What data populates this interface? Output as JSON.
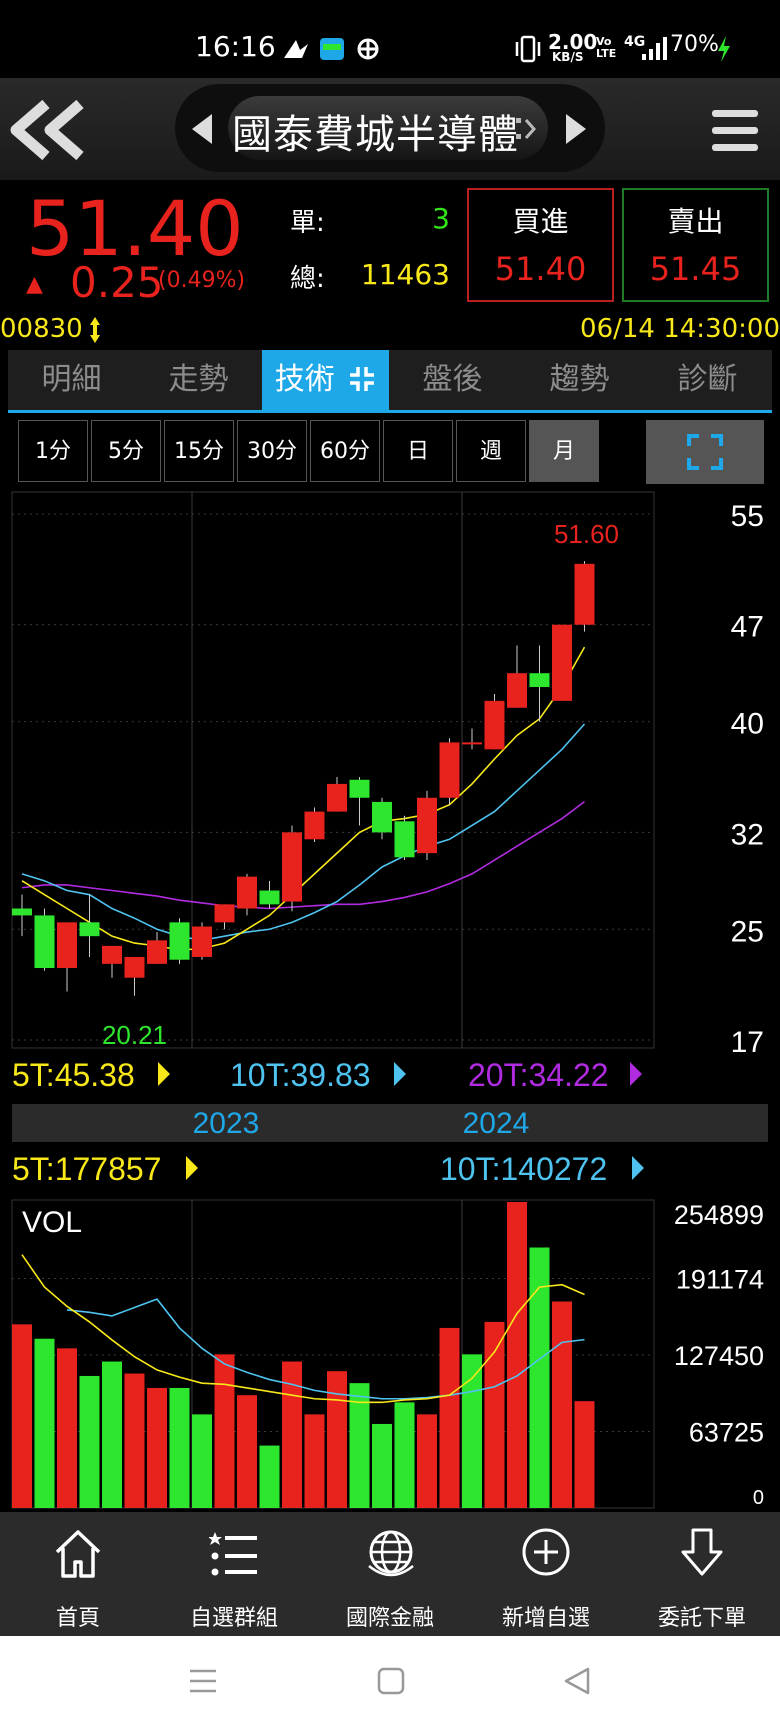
{
  "status": {
    "time": "16:16",
    "net_speed": "2.00",
    "net_unit": "KB/S",
    "volte": "Vo LTE",
    "net_type": "4G",
    "battery": "70%"
  },
  "header": {
    "title": "國泰費城半導體"
  },
  "quote": {
    "price": "51.40",
    "change_arrow": "▲",
    "change": "0.25",
    "change_pct": "(0.49%)",
    "single_label": "單:",
    "single_value": "3",
    "total_label": "總:",
    "total_value": "11463",
    "buy_label": "買進",
    "buy_price": "51.40",
    "sell_label": "賣出",
    "sell_price": "51.45"
  },
  "codebar": {
    "code": "00830",
    "datetime": "06/14 14:30:00"
  },
  "tabs": [
    "明細",
    "走勢",
    "技術",
    "盤後",
    "趨勢",
    "診斷"
  ],
  "active_tab": 2,
  "periods": [
    "1分",
    "5分",
    "15分",
    "30分",
    "60分",
    "日",
    "週",
    "月"
  ],
  "active_period": 7,
  "ma_legend": {
    "ma5": "5T:45.38",
    "ma10": "10T:39.83",
    "ma20": "20T:34.22"
  },
  "year_labels": [
    "2023",
    "2024"
  ],
  "vol_legend": {
    "ma5": "5T:177857",
    "ma10": "10T:140272",
    "title": "VOL"
  },
  "price_high_label": "51.60",
  "price_low_label": "20.21",
  "nav": [
    "首頁",
    "自選群組",
    "國際金融",
    "新增自選",
    "委託下單"
  ],
  "colors": {
    "up": "#e8221d",
    "down": "#2de62d",
    "ma5": "#f8e81a",
    "ma10": "#4fc3f0",
    "ma20": "#b12be0",
    "accent": "#1fa8e8"
  },
  "chart_data": [
    {
      "type": "candlestick",
      "ylim": [
        17,
        55
      ],
      "y_ticks": [
        55,
        47,
        40,
        32,
        25,
        17
      ],
      "candles": [
        {
          "o": 26.5,
          "h": 27.5,
          "l": 24.5,
          "c": 26.0
        },
        {
          "o": 26.0,
          "h": 26.5,
          "l": 22.0,
          "c": 22.2
        },
        {
          "o": 22.2,
          "h": 25.5,
          "l": 20.5,
          "c": 25.5
        },
        {
          "o": 25.5,
          "h": 27.5,
          "l": 23.0,
          "c": 24.5
        },
        {
          "o": 22.5,
          "h": 23.8,
          "l": 21.5,
          "c": 23.8
        },
        {
          "o": 21.5,
          "h": 22.8,
          "l": 20.21,
          "c": 23.0
        },
        {
          "o": 22.5,
          "h": 24.8,
          "l": 22.5,
          "c": 24.2
        },
        {
          "o": 25.5,
          "h": 25.8,
          "l": 22.5,
          "c": 22.8
        },
        {
          "o": 23.0,
          "h": 25.5,
          "l": 22.8,
          "c": 25.2
        },
        {
          "o": 25.5,
          "h": 26.8,
          "l": 25.0,
          "c": 26.8
        },
        {
          "o": 26.5,
          "h": 29.0,
          "l": 26.0,
          "c": 28.8
        },
        {
          "o": 27.8,
          "h": 28.5,
          "l": 26.5,
          "c": 26.8
        },
        {
          "o": 27.0,
          "h": 32.5,
          "l": 26.3,
          "c": 32.0
        },
        {
          "o": 31.5,
          "h": 33.8,
          "l": 31.3,
          "c": 33.5
        },
        {
          "o": 33.5,
          "h": 36.0,
          "l": 33.5,
          "c": 35.5
        },
        {
          "o": 35.8,
          "h": 36.0,
          "l": 32.5,
          "c": 34.5
        },
        {
          "o": 34.2,
          "h": 34.5,
          "l": 31.5,
          "c": 32.0
        },
        {
          "o": 32.8,
          "h": 33.2,
          "l": 30.0,
          "c": 30.2
        },
        {
          "o": 30.5,
          "h": 35.0,
          "l": 30.0,
          "c": 34.5
        },
        {
          "o": 34.5,
          "h": 38.8,
          "l": 34.0,
          "c": 38.5
        },
        {
          "o": 38.5,
          "h": 39.5,
          "l": 38.0,
          "c": 38.5
        },
        {
          "o": 38.0,
          "h": 42.0,
          "l": 38.0,
          "c": 41.5
        },
        {
          "o": 41.0,
          "h": 45.5,
          "l": 41.0,
          "c": 43.5
        },
        {
          "o": 43.5,
          "h": 45.5,
          "l": 40.0,
          "c": 42.5
        },
        {
          "o": 41.5,
          "h": 47.0,
          "l": 41.5,
          "c": 47.0
        },
        {
          "o": 47.0,
          "h": 51.6,
          "l": 46.5,
          "c": 51.4
        }
      ],
      "ma5": [
        28.5,
        27.5,
        26.5,
        25.5,
        24.5,
        24.0,
        23.8,
        23.5,
        23.6,
        24.0,
        25.0,
        26.0,
        27.5,
        29.0,
        30.5,
        32.0,
        32.8,
        33.0,
        33.3,
        34.0,
        35.5,
        37.3,
        39.0,
        40.2,
        42.5,
        45.38
      ],
      "ma10": [
        29.0,
        28.5,
        27.8,
        27.5,
        26.5,
        25.8,
        25.0,
        24.5,
        24.2,
        24.5,
        24.8,
        25.0,
        25.5,
        26.2,
        27.0,
        28.2,
        29.5,
        30.3,
        31.0,
        31.5,
        32.5,
        33.5,
        35.0,
        36.5,
        38.0,
        39.83
      ],
      "ma20": [
        28.0,
        28.2,
        28.2,
        28.0,
        27.8,
        27.6,
        27.4,
        27.1,
        26.9,
        26.7,
        26.6,
        26.5,
        26.6,
        26.7,
        26.8,
        26.8,
        27.0,
        27.3,
        27.7,
        28.3,
        29.0,
        30.0,
        31.0,
        32.0,
        33.0,
        34.22
      ]
    },
    {
      "type": "bar",
      "title": "VOL",
      "ylim": [
        0,
        254899
      ],
      "y_ticks": [
        254899,
        191174,
        127450,
        63725,
        0
      ],
      "values": [
        153000,
        141000,
        133000,
        110000,
        122000,
        112000,
        100000,
        100000,
        78000,
        128000,
        94000,
        52000,
        122000,
        78000,
        114000,
        104000,
        70000,
        88000,
        78000,
        150000,
        128000,
        155000,
        256000,
        217000,
        172000,
        89000
      ],
      "up": [
        1,
        0,
        1,
        0,
        0,
        1,
        1,
        0,
        0,
        1,
        1,
        0,
        1,
        1,
        1,
        0,
        0,
        0,
        1,
        1,
        0,
        1,
        1,
        0,
        1,
        1
      ],
      "ma5": [
        211000,
        184000,
        168000,
        155000,
        140000,
        126000,
        115000,
        109000,
        104000,
        103000,
        100000,
        97000,
        94000,
        91000,
        90000,
        88000,
        88000,
        90000,
        91000,
        94000,
        108000,
        130000,
        162000,
        184000,
        186000,
        177857
      ],
      "ma10": [
        0,
        0,
        165000,
        163000,
        160000,
        167000,
        174000,
        150000,
        133000,
        120000,
        113000,
        107000,
        103000,
        98000,
        95000,
        93000,
        91000,
        91000,
        92000,
        94000,
        97000,
        101000,
        110000,
        124000,
        138000,
        140272
      ]
    }
  ]
}
